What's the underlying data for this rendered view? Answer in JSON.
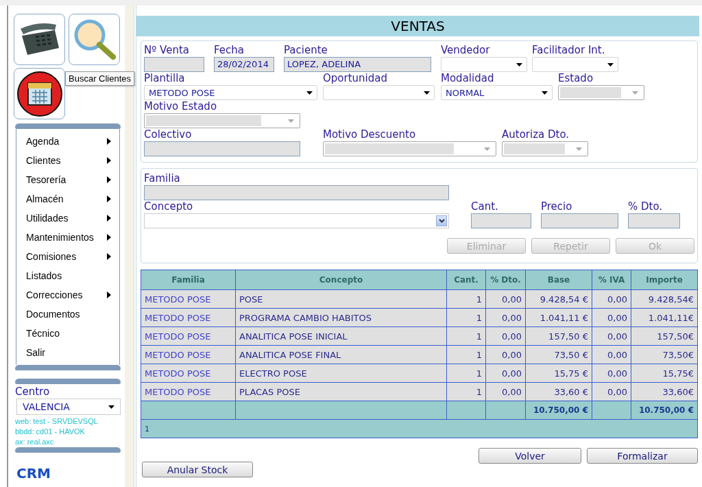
{
  "toolbar": {
    "tooltip": "Buscar Clientes"
  },
  "menu": [
    {
      "label": "Agenda",
      "has_submenu": true
    },
    {
      "label": "Clientes",
      "has_submenu": true
    },
    {
      "label": "Tesorería",
      "has_submenu": true
    },
    {
      "label": "Almacén",
      "has_submenu": true
    },
    {
      "label": "Utilidades",
      "has_submenu": true
    },
    {
      "label": "Mantenimientos",
      "has_submenu": true
    },
    {
      "label": "Comisiones",
      "has_submenu": true
    },
    {
      "label": "Listados",
      "has_submenu": false
    },
    {
      "label": "Correcciones",
      "has_submenu": true
    },
    {
      "label": "Documentos",
      "has_submenu": false
    },
    {
      "label": "Técnico",
      "has_submenu": false
    },
    {
      "label": "Salir",
      "has_submenu": false
    }
  ],
  "centro": {
    "label": "Centro",
    "value": "VALENCIA",
    "info": [
      "web: test - SRVDEVSQL",
      "bbdd: cd01 - HAVOK",
      "ax: real.axc"
    ]
  },
  "brand": "CRM",
  "title": "VENTAS",
  "header_form": [
    [
      {
        "label": "Nº Venta",
        "kind": "text"
      },
      {
        "label": "Fecha",
        "kind": "text",
        "value": "28/02/2014"
      },
      {
        "label": "Paciente",
        "kind": "text",
        "value": "LOPEZ, ADELINA"
      },
      {
        "label": "Vendedor",
        "kind": "select"
      },
      {
        "label": "Facilitador Int.",
        "kind": "select"
      }
    ],
    [
      {
        "label": "Plantilla",
        "kind": "select",
        "value": "METODO POSE"
      },
      {
        "label": "Oportunidad",
        "kind": "select"
      },
      {
        "label": "Modalidad",
        "kind": "select",
        "value": "NORMAL"
      },
      {
        "label": "Estado",
        "kind": "disabled-select"
      }
    ],
    [
      {
        "label": "Motivo Estado",
        "kind": "disabled-select"
      }
    ],
    [
      {
        "label": "Colectivo",
        "kind": "text"
      },
      {
        "label": "Motivo Descuento",
        "kind": "disabled-select"
      },
      {
        "label": "Autoriza Dto.",
        "kind": "disabled-select"
      }
    ]
  ],
  "line_form": {
    "familia": "Familia",
    "concepto": "Concepto",
    "cant": "Cant.",
    "precio": "Precio",
    "dto": "% Dto.",
    "buttons": [
      {
        "label": "Eliminar",
        "disabled": true
      },
      {
        "label": "Repetir",
        "disabled": true
      },
      {
        "label": "Ok",
        "disabled": true
      }
    ]
  },
  "table": {
    "columns": [
      "Familia",
      "Concepto",
      "Cant.",
      "% Dto.",
      "Base",
      "% IVA",
      "Importe"
    ],
    "rows": [
      [
        "METODO POSE",
        "POSE",
        "1",
        "0,00",
        "9.428,54 €",
        "0,00",
        "9.428,54€"
      ],
      [
        "METODO POSE",
        "PROGRAMA CAMBIO HABITOS",
        "1",
        "0,00",
        "1.041,11 €",
        "0,00",
        "1.041,11€"
      ],
      [
        "METODO POSE",
        "ANALITICA POSE INICIAL",
        "1",
        "0,00",
        "157,50 €",
        "0,00",
        "157,50€"
      ],
      [
        "METODO POSE",
        "ANALITICA POSE FINAL",
        "1",
        "0,00",
        "73,50 €",
        "0,00",
        "73,50€"
      ],
      [
        "METODO POSE",
        "ELECTRO POSE",
        "1",
        "0,00",
        "15,75 €",
        "0,00",
        "15,75€"
      ],
      [
        "METODO POSE",
        "PLACAS POSE",
        "1",
        "0,00",
        "33,60 €",
        "0,00",
        "33,60€"
      ]
    ],
    "totals": {
      "base": "10.750,00 €",
      "importe": "10.750,00 €"
    },
    "page": "1"
  },
  "actions": [
    {
      "label": "Volver"
    },
    {
      "label": "Formalizar"
    }
  ],
  "anular": "Anular Stock"
}
